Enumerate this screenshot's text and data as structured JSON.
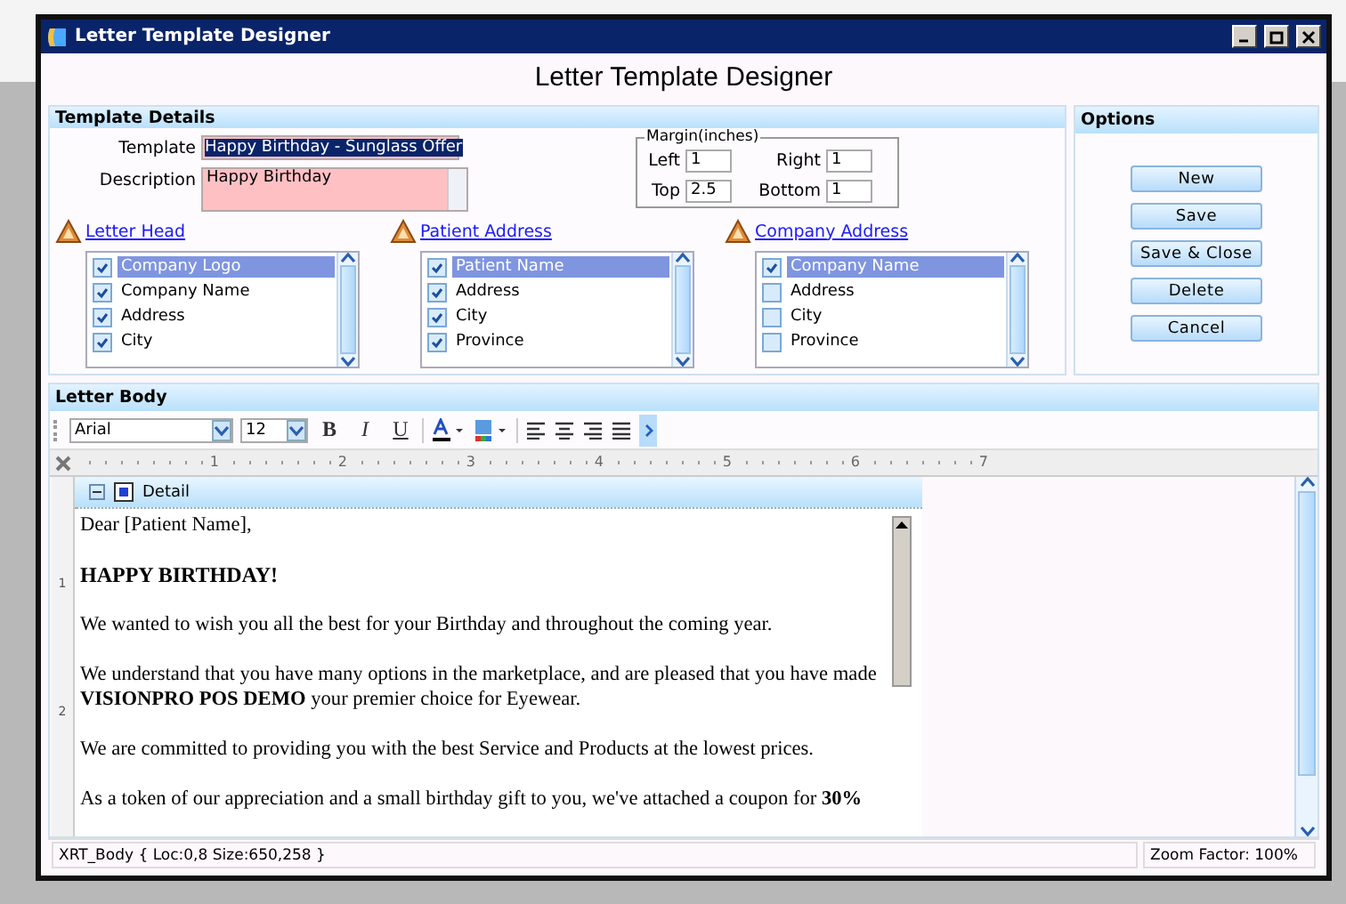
{
  "window": {
    "title": "Letter Template Designer",
    "heading": "Letter Template Designer"
  },
  "template_details": {
    "title": "Template Details",
    "template_label": "Template",
    "template_value": "Happy Birthday - Sunglass Offer",
    "description_label": "Description",
    "description_value": "Happy Birthday",
    "margin": {
      "title": "Margin(inches)",
      "fields": [
        {
          "label": "Left",
          "value": "1"
        },
        {
          "label": "Right",
          "value": "1"
        },
        {
          "label": "Top",
          "value": "2.5"
        },
        {
          "label": "Bottom",
          "value": "1"
        }
      ]
    },
    "field_groups": [
      {
        "title": "Letter Head",
        "items": [
          {
            "label": "Company Logo",
            "checked": true,
            "selected": true
          },
          {
            "label": "Company Name",
            "checked": true,
            "selected": false
          },
          {
            "label": "Address",
            "checked": true,
            "selected": false
          },
          {
            "label": "City",
            "checked": true,
            "selected": false
          }
        ]
      },
      {
        "title": "Patient Address",
        "items": [
          {
            "label": "Patient Name",
            "checked": true,
            "selected": true
          },
          {
            "label": "Address",
            "checked": true,
            "selected": false
          },
          {
            "label": "City",
            "checked": true,
            "selected": false
          },
          {
            "label": "Province",
            "checked": true,
            "selected": false
          }
        ]
      },
      {
        "title": "Company Address",
        "items": [
          {
            "label": "Company Name",
            "checked": true,
            "selected": true
          },
          {
            "label": "Address",
            "checked": false,
            "selected": false
          },
          {
            "label": "City",
            "checked": false,
            "selected": false
          },
          {
            "label": "Province",
            "checked": false,
            "selected": false
          }
        ]
      }
    ]
  },
  "options": {
    "title": "Options",
    "buttons": [
      "New",
      "Save",
      "Save & Close",
      "Delete",
      "Cancel"
    ]
  },
  "letter_body": {
    "title": "Letter Body",
    "font": "Arial",
    "size": "12",
    "format_buttons": [
      "B",
      "I",
      "U"
    ],
    "ruler_marks": [
      "1",
      "2",
      "3",
      "4",
      "5",
      "6",
      "7"
    ],
    "side_ruler_marks": [
      "1",
      "2"
    ],
    "band": "Detail",
    "paragraphs": [
      {
        "kind": "plain",
        "text": "Dear [Patient Name],"
      },
      {
        "kind": "heading",
        "text": "HAPPY BIRTHDAY!"
      },
      {
        "kind": "plain",
        "text": "We wanted to wish you all the best for your Birthday and throughout the coming year."
      },
      {
        "kind": "plain",
        "text": "We understand that you have many options in the marketplace, and are pleased that you have made **VISIONPRO POS DEMO** your premier choice for Eyewear."
      },
      {
        "kind": "plain",
        "text": "We are committed to providing you with the best Service and Products at the lowest prices."
      },
      {
        "kind": "plain",
        "text": "As a token of our appreciation and a small birthday gift to you, we've attached a coupon for **30%**"
      }
    ]
  },
  "status_bar": {
    "selection": "XRT_Body { Loc:0,8 Size:650,258 }",
    "zoom": "Zoom Factor: 100%"
  }
}
